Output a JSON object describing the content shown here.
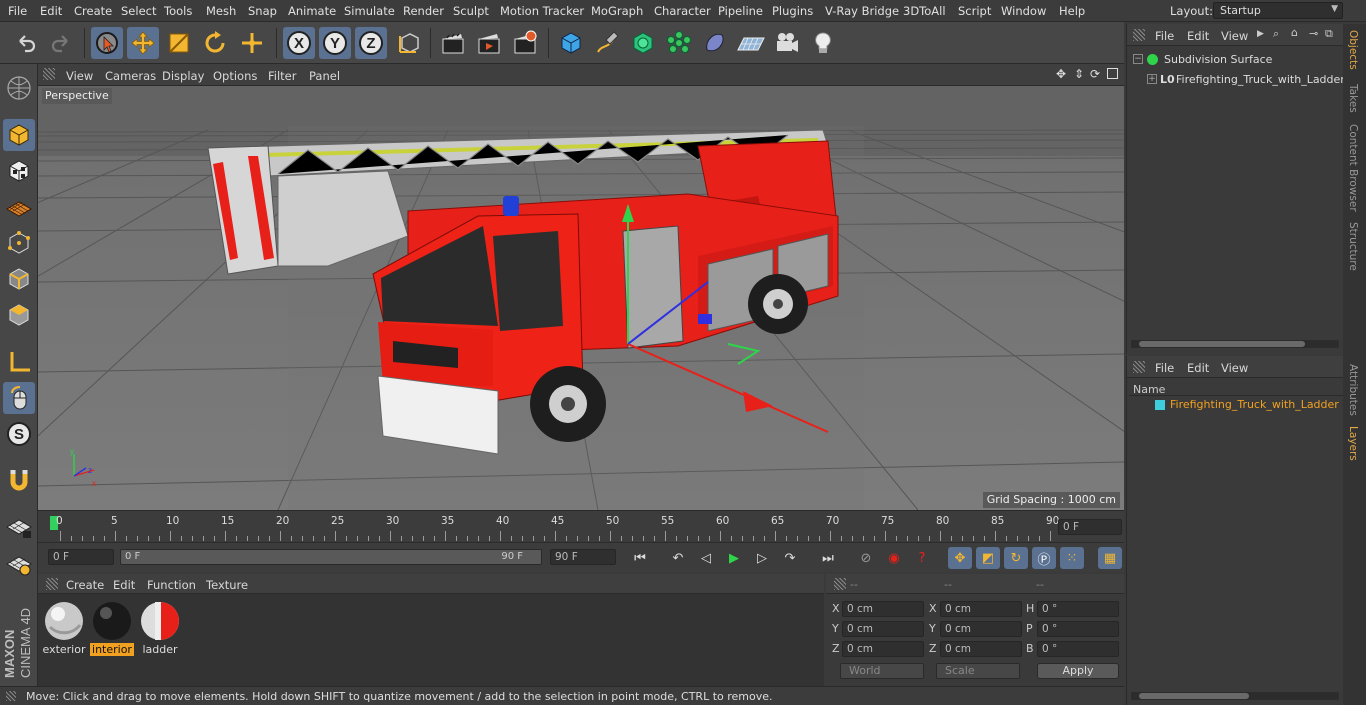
{
  "menubar": {
    "items": [
      "File",
      "Edit",
      "Create",
      "Select",
      "Tools",
      "Mesh",
      "Snap",
      "Animate",
      "Simulate",
      "Render",
      "Sculpt",
      "Motion Tracker",
      "MoGraph",
      "Character",
      "Pipeline",
      "Plugins",
      "V-Ray Bridge",
      "3DToAll",
      "Script",
      "Window",
      "Help"
    ],
    "layout_label": "Layout:",
    "layout_value": "Startup"
  },
  "viewport": {
    "menu": [
      "View",
      "Cameras",
      "Display",
      "Options",
      "Filter",
      "Panel"
    ],
    "label": "Perspective",
    "grid_spacing": "Grid Spacing : 1000 cm"
  },
  "timeline": {
    "ticks": [
      "0",
      "5",
      "10",
      "15",
      "20",
      "25",
      "30",
      "35",
      "40",
      "45",
      "50",
      "55",
      "60",
      "65",
      "70",
      "75",
      "80",
      "85",
      "90"
    ],
    "current_frame": "0 F",
    "start_field": "0 F",
    "range_start": "0 F",
    "range_end": "90 F",
    "end_field": "90 F"
  },
  "materials": {
    "menu": [
      "Create",
      "Edit",
      "Function",
      "Texture"
    ],
    "items": [
      {
        "name": "exterior",
        "selected": false
      },
      {
        "name": "interior",
        "selected": true
      },
      {
        "name": "ladder",
        "selected": false
      }
    ]
  },
  "coords": {
    "headers": [
      "--",
      "--",
      "--"
    ],
    "rows": [
      {
        "a": "X",
        "av": "0 cm",
        "b": "X",
        "bv": "0 cm",
        "c": "H",
        "cv": "0 °"
      },
      {
        "a": "Y",
        "av": "0 cm",
        "b": "Y",
        "bv": "0 cm",
        "c": "P",
        "cv": "0 °"
      },
      {
        "a": "Z",
        "av": "0 cm",
        "b": "Z",
        "bv": "0 cm",
        "c": "B",
        "cv": "0 °"
      }
    ],
    "mode": "World",
    "scale": "Scale",
    "apply": "Apply"
  },
  "status": "Move: Click and drag to move elements. Hold down SHIFT to quantize movement / add to the selection in point mode, CTRL to remove.",
  "objects": {
    "menu": [
      "File",
      "Edit",
      "View"
    ],
    "tree": [
      "Subdivision Surface",
      "Firefighting_Truck_with_Ladder"
    ]
  },
  "layers": {
    "menu": [
      "File",
      "Edit",
      "View"
    ],
    "column": "Name",
    "items": [
      "Firefighting_Truck_with_Ladder"
    ]
  },
  "side_tabs": [
    "Objects",
    "Takes",
    "Content Browser",
    "Structure",
    "Attributes",
    "Layers"
  ],
  "logo": [
    "MAXON",
    "CINEMA 4D"
  ],
  "colors": {
    "accent": "#5a7191",
    "orange": "#e2a94a",
    "layer": "#3ecfdc",
    "truck_red": "#ee1c12"
  }
}
